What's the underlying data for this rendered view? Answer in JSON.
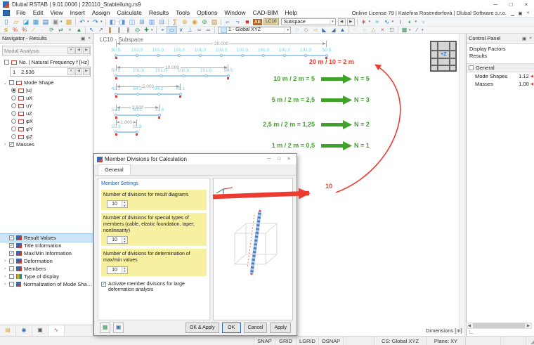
{
  "window": {
    "title": "Dlubal RSTAB | 9.01.0006 | 220110_Stabteilung.rs9",
    "license_text": "Online License 79 | Kateřina Rosendorfová | Dlubal Software s.r.o.",
    "controls": [
      {
        "name": "minimize-button",
        "glyph": "─"
      },
      {
        "name": "maximize-button",
        "glyph": "□"
      },
      {
        "name": "close-button",
        "glyph": "×"
      }
    ],
    "mdi_controls": [
      {
        "name": "mdi-minimize-button",
        "glyph": "▁"
      },
      {
        "name": "mdi-restore-button",
        "glyph": "▣"
      },
      {
        "name": "mdi-close-button",
        "glyph": "×"
      }
    ]
  },
  "menu": {
    "items": [
      "File",
      "Edit",
      "View",
      "Insert",
      "Assign",
      "Calculate",
      "Results",
      "Tools",
      "Options",
      "Window",
      "CAD-BIM",
      "Help"
    ]
  },
  "toolbar1": [
    {
      "n": "new-file-icon",
      "g": "▯",
      "c": "#4a86c8"
    },
    {
      "n": "open-file-icon",
      "g": "▱",
      "c": "#d9a43a"
    },
    {
      "n": "import-icon",
      "g": "◪",
      "c": "#3fa0c8"
    },
    {
      "n": "tables-icon",
      "g": "▦",
      "c": "#3f8fc8"
    },
    {
      "n": "save-icon",
      "g": "▤",
      "c": "#3a6fb0"
    },
    {
      "n": "print-icon",
      "g": "▣",
      "c": "#8a8a8a",
      "dd": true
    },
    {
      "n": "copy-icon",
      "g": "▩",
      "c": "#d9a43a"
    },
    {
      "sep": true
    },
    {
      "n": "undo-icon",
      "g": "↶",
      "c": "#3a6fb0",
      "dd": true
    },
    {
      "n": "redo-icon",
      "g": "↷",
      "c": "#3a6fb0",
      "dd": true
    },
    {
      "sep": true
    },
    {
      "n": "navigator-panel-icon",
      "g": "◧",
      "c": "#5b8dd9"
    },
    {
      "n": "tables-panel-icon",
      "g": "◨",
      "c": "#5b8dd9"
    },
    {
      "n": "panels-icon",
      "g": "◫",
      "c": "#5b8dd9"
    },
    {
      "n": "split-view-icon",
      "g": "⊞",
      "c": "#5b8dd9"
    },
    {
      "n": "layout-icon",
      "g": "▥",
      "c": "#5b8dd9"
    },
    {
      "n": "full-view-icon",
      "g": "⊟",
      "c": "#5b8dd9"
    },
    {
      "sep": true
    },
    {
      "n": "calculate-icon",
      "g": "∑",
      "c": "#c8883a"
    },
    {
      "n": "check-model-icon",
      "g": "⊚",
      "c": "#c8a43a"
    },
    {
      "n": "optimize-icon",
      "g": "◉",
      "c": "#c8a43a"
    },
    {
      "n": "show-results-icon",
      "g": "⊛",
      "c": "#3fa05f"
    },
    {
      "n": "graphics-icon",
      "g": "▨",
      "c": "#c8883a"
    },
    {
      "sep": true
    },
    {
      "n": "loads-icon",
      "g": "⌐",
      "c": "#3a6fb0"
    },
    {
      "n": "imperfections-icon",
      "g": "¬",
      "c": "#3a6fb0"
    },
    {
      "n": "results-color-icon",
      "g": "■",
      "c": "#e03c2d"
    },
    {
      "badge": "AE",
      "n": "analysis-badge"
    },
    {
      "chip": "LC10",
      "n": "load-case-chip"
    },
    {
      "combo": "Subspace",
      "w": 78,
      "n": "load-case-combo"
    },
    {
      "nav": "◀",
      "n": "previous-load-case-button"
    },
    {
      "nav": "▶",
      "n": "next-load-case-button"
    },
    {
      "sep": true
    },
    {
      "n": "mode-shape-icon",
      "g": "∗",
      "c": "#c94f44",
      "dd": true
    },
    {
      "n": "animation-icon",
      "g": "≈",
      "c": "#3a9fb0"
    },
    {
      "n": "result-diagrams-icon",
      "g": "∿",
      "c": "#3a6fb0",
      "dd": true
    },
    {
      "n": "result-values-toolbar-icon",
      "g": "≀",
      "c": "#3a6fb0"
    },
    {
      "n": "visibility-icon",
      "g": "◐",
      "c": "#3a8f5f",
      "dd": true
    },
    {
      "n": "clipping-icon",
      "g": "▫",
      "c": "#8a8a8a"
    }
  ],
  "toolbar2": [
    {
      "n": "generate-icon",
      "g": "≶",
      "c": "#c8a43a"
    },
    {
      "n": "percent-off-icon",
      "g": "%",
      "c": "#c94f44"
    },
    {
      "n": "percent-on-icon",
      "g": "%",
      "c": "#c94f44"
    },
    {
      "n": "new-member-icon",
      "g": "∕",
      "c": "#d9a43a"
    },
    {
      "n": "new-node-icon",
      "g": "∙",
      "c": "#d9a43a"
    },
    {
      "n": "rotate-icon",
      "g": "⟳",
      "c": "#3a8f5f"
    },
    {
      "n": "mirror-icon",
      "g": "⇄",
      "c": "#3a8f5f"
    },
    {
      "n": "delete-small-icon",
      "g": "×",
      "c": "#8a8a8a"
    },
    {
      "n": "support-icon",
      "g": "▲",
      "c": "#3a8f5f"
    },
    {
      "sep": true
    },
    {
      "n": "move-icon",
      "g": "↖",
      "c": "#3a6fb0"
    },
    {
      "n": "copy-move-icon",
      "g": "↗",
      "c": "#3a6fb0"
    },
    {
      "n": "extrude-icon",
      "g": "❚",
      "c": "#c8883a"
    },
    {
      "n": "divide-member-icon",
      "g": "∥",
      "c": "#555555"
    },
    {
      "n": "connect-members-icon",
      "g": "∦",
      "c": "#555555"
    },
    {
      "n": "measure-icon",
      "g": "◎",
      "c": "#3a8f5f"
    },
    {
      "n": "dimensions-icon",
      "g": "✚",
      "c": "#3a8f5f",
      "dd": true
    },
    {
      "sep": true
    },
    {
      "n": "select-pointer-icon",
      "g": "⌖",
      "c": "#3a6fb0"
    },
    {
      "n": "select-window-icon",
      "g": "▭",
      "c": "#3a6fb0",
      "sel": true
    },
    {
      "n": "select-special-icon",
      "g": "∨",
      "c": "#3a6fb0"
    },
    {
      "n": "snap-perpendicular-icon",
      "g": "⊥",
      "c": "#3a6fb0"
    },
    {
      "n": "work-plane-icon",
      "g": "≂",
      "c": "#8a8a8a"
    },
    {
      "n": "grid-settings-icon",
      "g": "≃",
      "c": "#8a8a8a"
    },
    {
      "sep": true
    },
    {
      "combo": "1 - Global XYZ",
      "w": 104,
      "n": "work-plane-combo",
      "tile": true
    },
    {
      "n": "zoom-icon",
      "g": "◌",
      "c": "#3a6fb0"
    },
    {
      "n": "isometric-view-icon",
      "g": "◇",
      "c": "#8a8a8a"
    },
    {
      "n": "previous-view-icon",
      "g": "◅",
      "c": "#d9a43a"
    },
    {
      "n": "view-x-icon",
      "g": "◣",
      "c": "#3a6fb0"
    },
    {
      "n": "view-y-icon",
      "g": "◢",
      "c": "#3a6fb0"
    },
    {
      "n": "view-z-icon",
      "g": "▲",
      "c": "#3a6fb0"
    },
    {
      "sep": true
    },
    {
      "n": "ghost-mode-icon",
      "g": "◌",
      "c": "#b0b0b0"
    },
    {
      "n": "ghost-render-icon",
      "g": "○",
      "c": "#b0b0b0"
    },
    {
      "n": "warning-icon",
      "g": "△",
      "c": "#d9a43a"
    },
    {
      "n": "delete-results-icon",
      "g": "×",
      "c": "#c94f44"
    },
    {
      "n": "camera-icon",
      "g": "⊡",
      "c": "#8a8a8a"
    },
    {
      "sep": true
    },
    {
      "n": "display-properties-icon",
      "g": "▦",
      "c": "#3a8f5f",
      "dd": true
    },
    {
      "n": "line-style-icon",
      "g": "∕",
      "c": "#3a6fb0",
      "dd": true
    }
  ],
  "navigator": {
    "title": "Navigator - Results",
    "analysis_type": "Modal Analysis",
    "frequency_header": "No. | Natural Frequency f [Hz]",
    "frequency_no": "1",
    "frequency_value": "2.536",
    "mode_shape_label": "Mode Shape",
    "mode_shapes": [
      {
        "label": "|u|",
        "selected": true
      },
      {
        "label": "uX",
        "selected": false
      },
      {
        "label": "uY",
        "selected": false
      },
      {
        "label": "uZ",
        "selected": false
      },
      {
        "label": "φX",
        "selected": false
      },
      {
        "label": "φY",
        "selected": false
      },
      {
        "label": "φZ",
        "selected": false
      }
    ],
    "masses_label": "Masses",
    "options": [
      {
        "label": "Result Values",
        "checked": true,
        "selected": true,
        "caret": false,
        "icon": "result-values-icon"
      },
      {
        "label": "Title Information",
        "checked": true,
        "selected": false,
        "caret": false,
        "icon": "title-information-icon"
      },
      {
        "label": "Max/Min Information",
        "checked": true,
        "selected": false,
        "caret": false,
        "icon": "maxmin-information-icon"
      },
      {
        "label": "Deformation",
        "checked": false,
        "selected": false,
        "caret": true,
        "icon": "deformation-icon"
      },
      {
        "label": "Members",
        "checked": false,
        "selected": false,
        "caret": true,
        "icon": "members-icon"
      },
      {
        "label": "Type of display",
        "checked": false,
        "selected": false,
        "caret": true,
        "icon": "type-of-display-icon"
      },
      {
        "label": "Normalization of Mode Shapes",
        "checked": false,
        "selected": false,
        "caret": true,
        "icon": "normalization-icon"
      }
    ],
    "tabs": [
      {
        "name": "tab-data",
        "glyph": "▤",
        "color": "#d9a43a",
        "selected": false
      },
      {
        "name": "tab-display",
        "glyph": "◉",
        "color": "#3a6fb0",
        "selected": false
      },
      {
        "name": "tab-views",
        "glyph": "▣",
        "color": "#555555",
        "selected": false
      },
      {
        "name": "tab-results",
        "glyph": "∿",
        "color": "#c94f44",
        "selected": true
      }
    ]
  },
  "canvas": {
    "view_label": "LC10 - Subspace",
    "beams": [
      {
        "length_m": 20,
        "divisions": 10,
        "dim": "20.000",
        "values": [
          "50.5",
          "101.0",
          "101.0",
          "101.0",
          "101.0",
          "101.0",
          "101.0",
          "101.0",
          "101.0",
          "101.0",
          "50.5"
        ]
      },
      {
        "length_m": 10,
        "divisions": 5,
        "dim": "10.000",
        "values": [
          "50.5",
          "101.0",
          "101.0",
          "101.0",
          "101.0",
          "50.5"
        ]
      },
      {
        "length_m": 5,
        "divisions": 3,
        "dim": "5.000",
        "values": [
          "42.1",
          "84.2",
          "84.2",
          "42.1"
        ]
      },
      {
        "length_m": 2.5,
        "divisions": 2,
        "dim": "2.500",
        "values": [
          "31.6",
          "63.1",
          "31.6"
        ]
      },
      {
        "length_m": 1,
        "divisions": 1,
        "dim": "1.000",
        "values": [
          "25.3",
          "25.3"
        ]
      }
    ],
    "red_formula": "20 m / 10 = 2 m",
    "red_value": "10",
    "annotations": [
      {
        "formula": "10 m / 2 m = 5",
        "result": "N = 5"
      },
      {
        "formula": "5 m / 2 m = 2,5",
        "result": "N = 3"
      },
      {
        "formula": "2,5 m / 2 m = 1,25",
        "result": "N = 2"
      },
      {
        "formula": "1 m / 2 m = 0,5",
        "result": "N = 1"
      }
    ],
    "nav_cube_label": "+Z",
    "annotation_green": "#3fa329",
    "annotation_red": "#ee3b30",
    "result_cyan": "#6fd1e8"
  },
  "dialog": {
    "title": "Member Divisions for Calculation",
    "tab": "General",
    "section": "Member Settings",
    "fields": [
      {
        "label": "Number of divisions for result diagrams",
        "value": "10"
      },
      {
        "label": "Number of divisions for special types of members (cable, elastic foundation, taper, nonlinearity)",
        "value": "10"
      },
      {
        "label": "Number of divisions for determination of max/min values",
        "value": "10"
      }
    ],
    "checkbox_label": "Activate member divisions for large deformation analysis",
    "checkbox_checked": true,
    "buttons": [
      "OK & Apply",
      "OK",
      "Cancel",
      "Apply"
    ],
    "window_buttons": [
      {
        "name": "dialog-minimize-button",
        "glyph": "─"
      },
      {
        "name": "dialog-maximize-button",
        "glyph": "□"
      },
      {
        "name": "dialog-close-button",
        "glyph": "×"
      }
    ],
    "tool_icons": [
      {
        "name": "dialog-units-button",
        "glyph": "▦",
        "color": "#3a8f5f"
      },
      {
        "name": "dialog-copy-settings-button",
        "glyph": "▣",
        "color": "#3a6fb0"
      }
    ],
    "highlight_color": "#f7f0a0"
  },
  "control_panel": {
    "title": "Control Panel",
    "subtitle_line1": "Display Factors",
    "subtitle_line2": "Results",
    "group_label": "General",
    "rows": [
      {
        "label": "Mode Shapes",
        "value": "1.12"
      },
      {
        "label": "Masses",
        "value": "1.00"
      }
    ]
  },
  "status": {
    "toggles": [
      "SNAP",
      "GRID",
      "LGRID",
      "OSNAP"
    ],
    "cs": "CS: Global XYZ",
    "plane": "Plane: XY",
    "dimensions_label": "Dimensions [m]"
  }
}
